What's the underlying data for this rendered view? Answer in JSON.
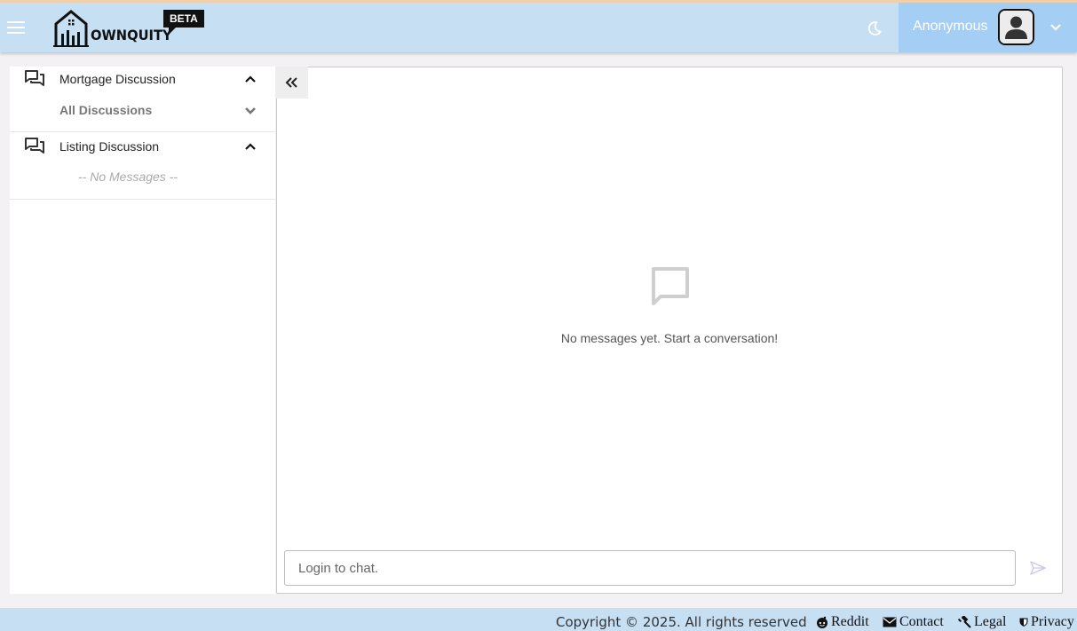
{
  "header": {
    "menu_icon": "hamburger-icon",
    "logo_text": "OWNQUITY",
    "beta_label": "BETA",
    "theme_icon": "moon-icon",
    "user_name": "Anonymous",
    "avatar_icon": "user-avatar-icon",
    "user_menu_icon": "chevron-down-icon"
  },
  "sidebar": {
    "groups": [
      {
        "label": "Mortgage Discussion",
        "icon": "chat-bubbles-icon",
        "expanded": true,
        "sub_label": "All Discussions"
      },
      {
        "label": "Listing Discussion",
        "icon": "chat-bubbles-icon",
        "expanded": true,
        "empty_text": "-- No Messages --"
      }
    ],
    "collapse_icon": "double-chevron-left-icon"
  },
  "chat": {
    "empty_icon": "message-square-icon",
    "empty_text": "No messages yet. Start a conversation!",
    "input_placeholder": "Login to chat.",
    "send_icon": "send-icon"
  },
  "footer": {
    "copyright": "Copyright © 2025. All rights reserved",
    "links": [
      {
        "label": "Reddit",
        "icon": "reddit-icon"
      },
      {
        "label": "Contact",
        "icon": "envelope-icon"
      },
      {
        "label": "Legal",
        "icon": "gavel-icon"
      },
      {
        "label": "Privacy",
        "icon": "shield-icon"
      }
    ]
  },
  "colors": {
    "header_bg": "#c7dff3",
    "user_area_bg": "#a4cef4",
    "page_bg": "#f3f1f4"
  }
}
